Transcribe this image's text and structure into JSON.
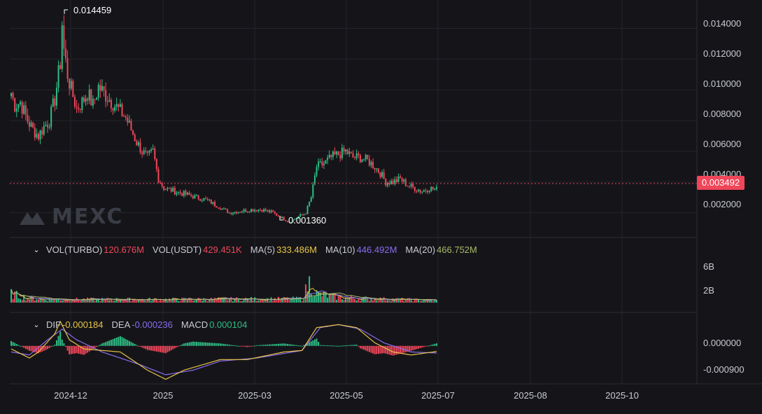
{
  "brand": {
    "name": "MEXC"
  },
  "colors": {
    "up": "#2ebd85",
    "down": "#f0465a",
    "ma5": "#e8c547",
    "ma10": "#8a6cf0",
    "ma20": "#a9b96a",
    "grid": "#24252b",
    "axis_text": "#c9cbd1"
  },
  "price_pane": {
    "yaxis_ticks": [
      "0.014000",
      "0.012000",
      "0.010000",
      "0.008000",
      "0.006000",
      "0.004000",
      "0.002000"
    ],
    "current_price": "0.003492",
    "high_label": "0.014459",
    "low_label": "0.001360"
  },
  "volume_pane": {
    "legend": {
      "vol_turbo_label": "VOL(TURBO)",
      "vol_turbo_value": "120.676M",
      "vol_usdt_label": "VOL(USDT)",
      "vol_usdt_value": "429.451K",
      "ma5_label": "MA(5)",
      "ma5_value": "333.486M",
      "ma10_label": "MA(10)",
      "ma10_value": "446.492M",
      "ma20_label": "MA(20)",
      "ma20_value": "466.752M"
    },
    "yaxis_ticks": [
      "6B",
      "2B"
    ]
  },
  "macd_pane": {
    "legend": {
      "dif_label": "DIF",
      "dif_value": "-0.000184",
      "dea_label": "DEA",
      "dea_value": "-0.000236",
      "macd_label": "MACD",
      "macd_value": "0.000104"
    },
    "yaxis_ticks": [
      "0.000000",
      "-0.000900"
    ]
  },
  "xaxis_ticks": [
    "2024-12",
    "2025",
    "2025-03",
    "2025-05",
    "2025-07",
    "2025-08",
    "2025-10"
  ],
  "chart_data": {
    "type": "candlestick",
    "price_ylim": [
      0.0008,
      0.0153
    ],
    "close_anchors": [
      [
        0,
        0.0098
      ],
      [
        2,
        0.009
      ],
      [
        5,
        0.0092
      ],
      [
        9,
        0.008
      ],
      [
        12,
        0.0074
      ],
      [
        15,
        0.007
      ],
      [
        18,
        0.0076
      ],
      [
        21,
        0.008
      ],
      [
        24,
        0.0094
      ],
      [
        27,
        0.0118
      ],
      [
        29,
        0.0126
      ],
      [
        31,
        0.011
      ],
      [
        33,
        0.01
      ],
      [
        36,
        0.0088
      ],
      [
        39,
        0.0092
      ],
      [
        42,
        0.0098
      ],
      [
        45,
        0.009
      ],
      [
        48,
        0.0102
      ],
      [
        51,
        0.0098
      ],
      [
        54,
        0.0094
      ],
      [
        57,
        0.009
      ],
      [
        60,
        0.0086
      ],
      [
        63,
        0.0082
      ],
      [
        66,
        0.0074
      ],
      [
        69,
        0.0066
      ],
      [
        72,
        0.006
      ],
      [
        75,
        0.0056
      ],
      [
        78,
        0.006
      ],
      [
        81,
        0.0042
      ],
      [
        84,
        0.0036
      ],
      [
        90,
        0.0034
      ],
      [
        96,
        0.0032
      ],
      [
        102,
        0.003
      ],
      [
        108,
        0.0028
      ],
      [
        114,
        0.0024
      ],
      [
        120,
        0.002
      ],
      [
        126,
        0.0021
      ],
      [
        132,
        0.0022
      ],
      [
        138,
        0.0022
      ],
      [
        144,
        0.002
      ],
      [
        150,
        0.0016
      ],
      [
        153,
        0.0014
      ],
      [
        156,
        0.0016
      ],
      [
        162,
        0.002
      ],
      [
        165,
        0.003
      ],
      [
        168,
        0.005
      ],
      [
        172,
        0.0052
      ],
      [
        176,
        0.0056
      ],
      [
        180,
        0.0058
      ],
      [
        184,
        0.006
      ],
      [
        188,
        0.0056
      ],
      [
        192,
        0.0056
      ],
      [
        196,
        0.0054
      ],
      [
        200,
        0.005
      ],
      [
        203,
        0.0046
      ],
      [
        206,
        0.004
      ],
      [
        210,
        0.004
      ],
      [
        214,
        0.0042
      ],
      [
        218,
        0.0038
      ],
      [
        222,
        0.0036
      ],
      [
        226,
        0.0034
      ],
      [
        230,
        0.0036
      ],
      [
        234,
        0.0035
      ]
    ],
    "candle_count": 235,
    "x_dates": {
      "start": "2024-10-22",
      "end": "2025-07-01"
    },
    "volume_ylim": [
      0,
      8000000000
    ],
    "volume_anchors": [
      [
        0,
        1400000000
      ],
      [
        10,
        700000000
      ],
      [
        30,
        500000000
      ],
      [
        80,
        500000000
      ],
      [
        160,
        600000000
      ],
      [
        164,
        3200000000
      ],
      [
        168,
        1400000000
      ],
      [
        180,
        800000000
      ],
      [
        200,
        600000000
      ],
      [
        234,
        350000000
      ]
    ],
    "macd_ylim": [
      -0.00125,
      0.0011
    ],
    "dif_anchors": [
      [
        0,
        -0.0001
      ],
      [
        10,
        -0.0004
      ],
      [
        15,
        -0.0002
      ],
      [
        24,
        0.0004
      ],
      [
        27,
        0.0008
      ],
      [
        32,
        0.0002
      ],
      [
        40,
        -0.0001
      ],
      [
        60,
        -0.0002
      ],
      [
        75,
        -0.0008
      ],
      [
        85,
        -0.0011
      ],
      [
        95,
        -0.0008
      ],
      [
        115,
        -0.00045
      ],
      [
        130,
        -0.00045
      ],
      [
        150,
        -0.0002
      ],
      [
        160,
        -0.00015
      ],
      [
        168,
        0.0006
      ],
      [
        180,
        0.0007
      ],
      [
        190,
        0.0006
      ],
      [
        200,
        0.0001
      ],
      [
        210,
        -0.0002
      ],
      [
        220,
        -0.0003
      ],
      [
        234,
        -0.000184
      ]
    ],
    "dea_anchors": [
      [
        0,
        -0.0002
      ],
      [
        10,
        -0.0003
      ],
      [
        20,
        0.0002
      ],
      [
        28,
        0.00055
      ],
      [
        36,
        0.0002
      ],
      [
        50,
        -0.0002
      ],
      [
        70,
        -0.0006
      ],
      [
        85,
        -0.00095
      ],
      [
        100,
        -0.0008
      ],
      [
        115,
        -0.0005
      ],
      [
        135,
        -0.0004
      ],
      [
        160,
        -0.00015
      ],
      [
        170,
        0.0006
      ],
      [
        180,
        0.0007
      ],
      [
        192,
        0.00055
      ],
      [
        205,
        0.0001
      ],
      [
        220,
        -0.0002
      ],
      [
        234,
        -0.000236
      ]
    ]
  }
}
